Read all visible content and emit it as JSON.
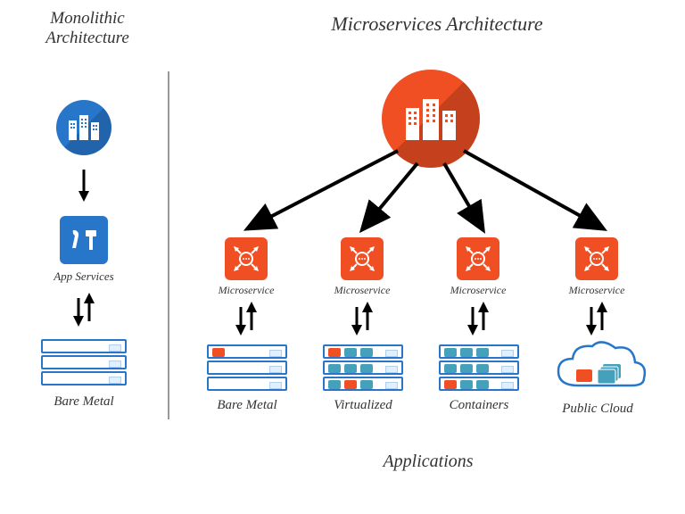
{
  "titles": {
    "monolithic": "Monolithic\nArchitecture",
    "microservices": "Microservices Architecture"
  },
  "left": {
    "app_services": "App Services",
    "bare_metal": "Bare Metal"
  },
  "right": {
    "microservice_labels": [
      "Microservice",
      "Microservice",
      "Microservice",
      "Microservice"
    ],
    "targets": [
      "Bare Metal",
      "Virtualized",
      "Containers",
      "Public Cloud"
    ],
    "bottom_label": "Applications"
  },
  "colors": {
    "blue": "#2876c9",
    "light_blue": "#3a8de0",
    "orange": "#f04e23",
    "dark_orange": "#d6431b",
    "teal": "#45a0bc"
  }
}
